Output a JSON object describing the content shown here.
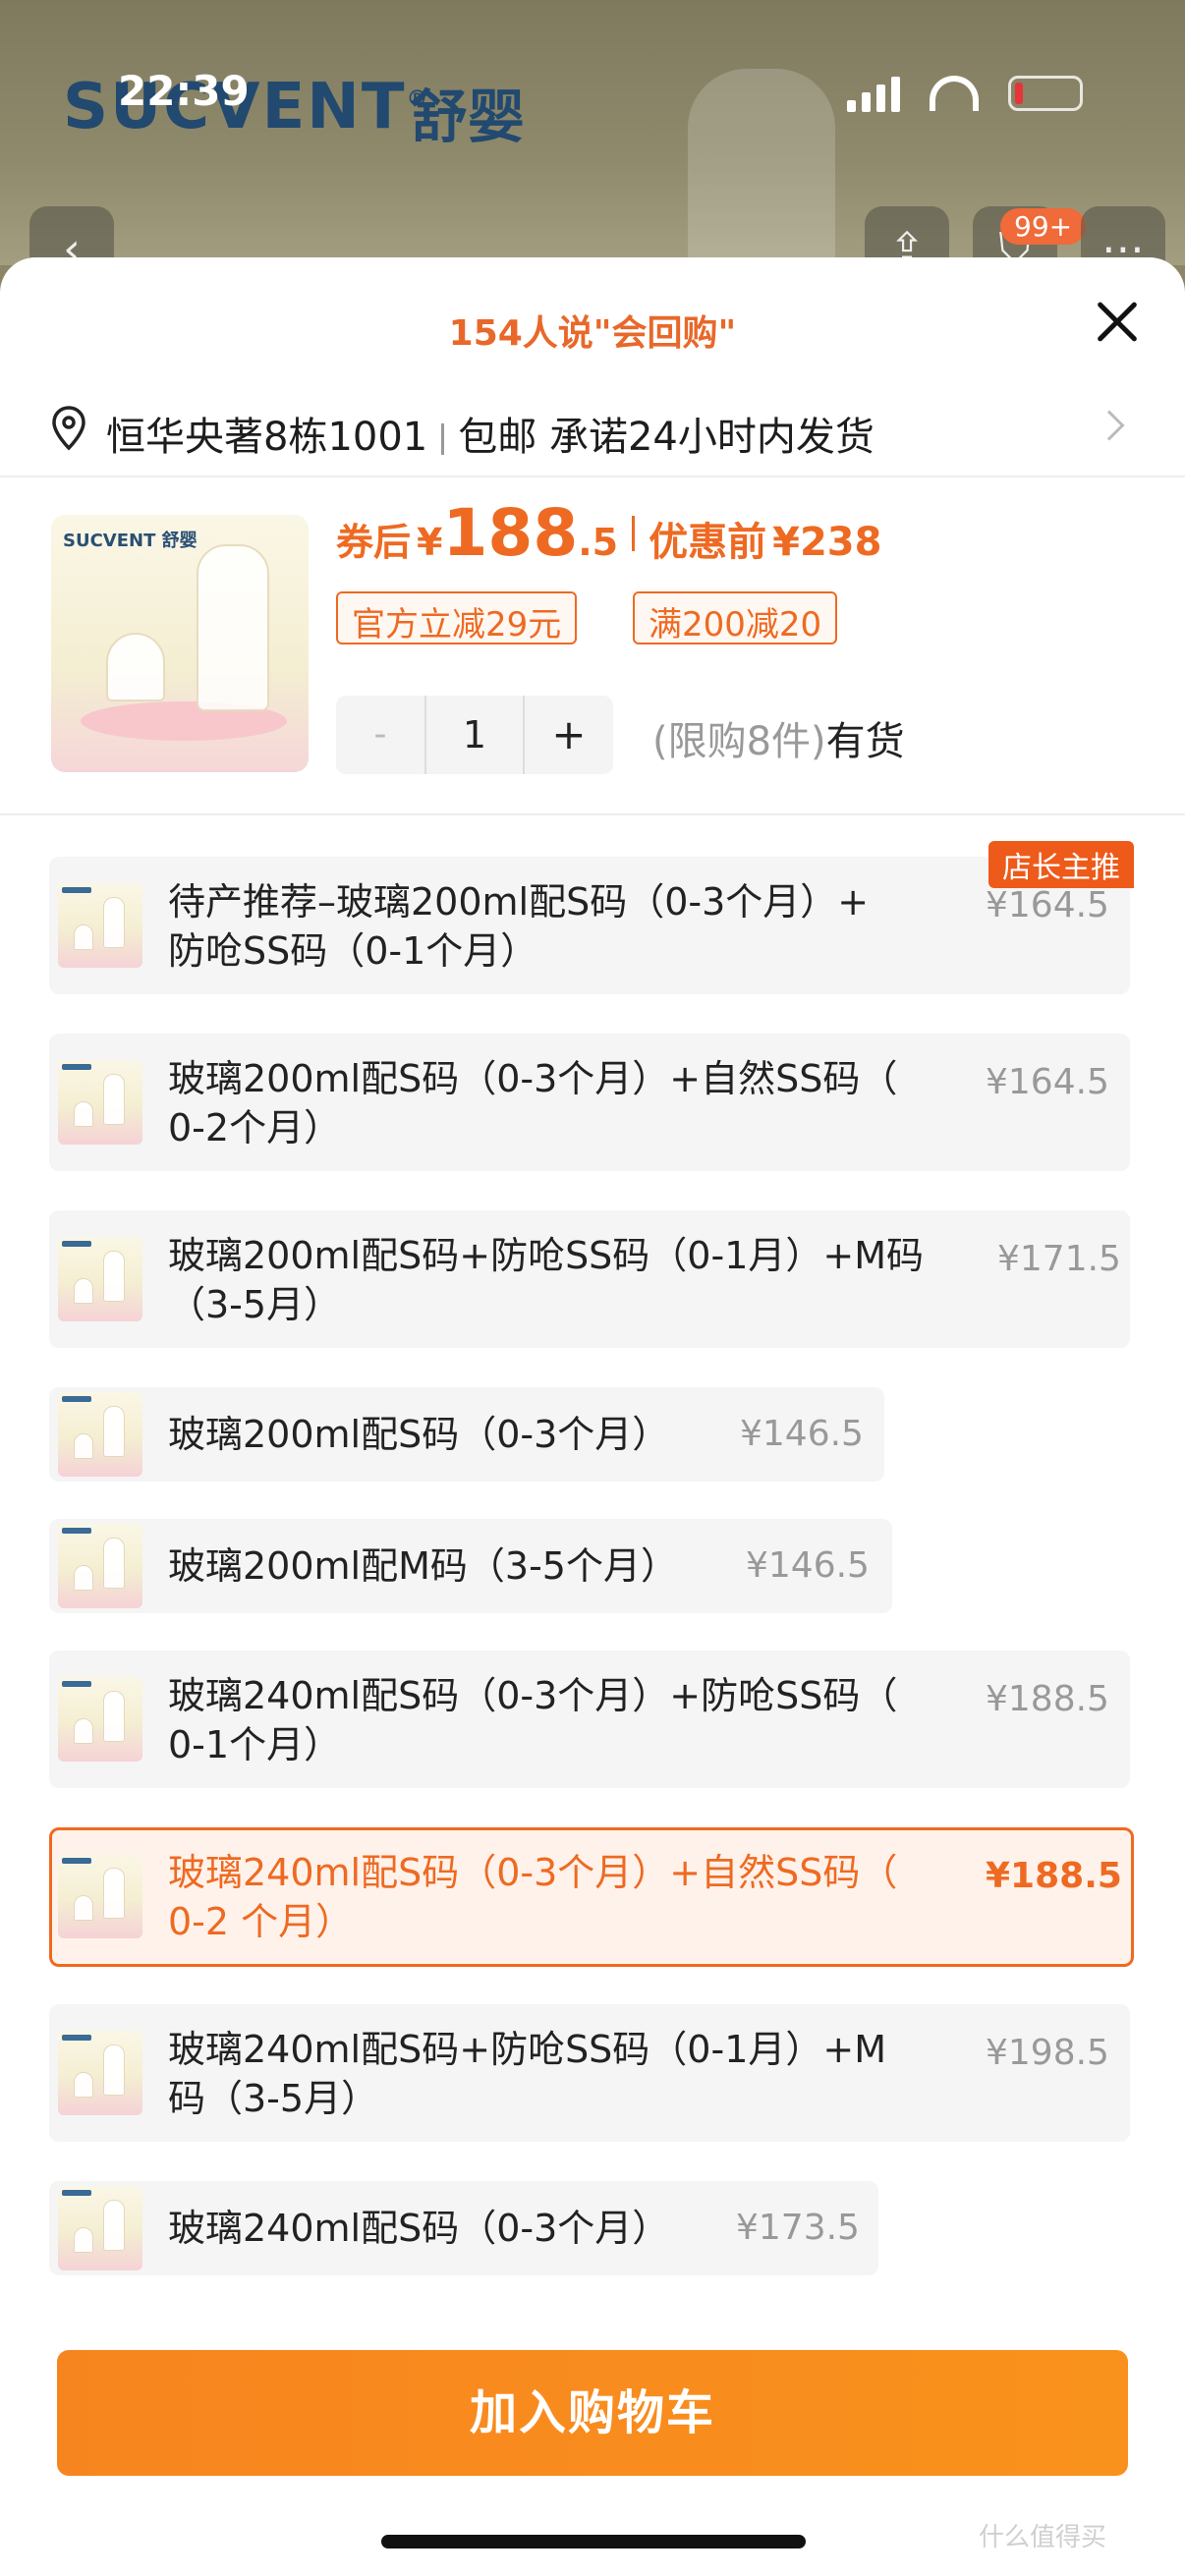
{
  "status_bar": {
    "time": "22:39"
  },
  "background": {
    "brand_logo_en": "SUCVENT",
    "brand_logo_mark": "®",
    "brand_logo_cn": "舒婴",
    "cart_badge": "99+"
  },
  "sheet": {
    "title": "154人说\"会回购\"",
    "address": "恒华央著8栋1001",
    "shipping": "包邮 承诺24小时内发货"
  },
  "product": {
    "thumb_logo": "SUCVENT 舒婴",
    "price_label": "券后",
    "currency": "¥",
    "price_integer": "188",
    "price_decimal": ".5",
    "original_label": "优惠前",
    "original_price": "¥238",
    "coupons": [
      "官方立减29元",
      "满200减20"
    ],
    "quantity": "1",
    "minus": "-",
    "plus": "+",
    "limit_text": "(限购8件)",
    "stock_text": "有货"
  },
  "recommend_tag": "店长主推",
  "options": [
    {
      "line1": "待产推荐–玻璃200ml配S码（0-3个月）+",
      "line2": "防呛SS码（0-1个月）",
      "price": "¥164.5",
      "selected": false
    },
    {
      "line1": "玻璃200ml配S码（0-3个月）+自然SS码（",
      "line2": "0-2个月）",
      "price": "¥164.5",
      "selected": false
    },
    {
      "line1": "玻璃200ml配S码+防呛SS码（0-1月）+M码",
      "line2": "（3-5月）",
      "price": "¥171.5",
      "selected": false
    },
    {
      "line1": "玻璃200ml配S码（0-3个月）",
      "line2": "",
      "price": "¥146.5",
      "selected": false
    },
    {
      "line1": "玻璃200ml配M码（3-5个月）",
      "line2": "",
      "price": "¥146.5",
      "selected": false
    },
    {
      "line1": "玻璃240ml配S码（0-3个月）+防呛SS码（",
      "line2": "0-1个月）",
      "price": "¥188.5",
      "selected": false
    },
    {
      "line1": "玻璃240ml配S码（0-3个月）+自然SS码（",
      "line2": "0-2 个月）",
      "price": "¥188.5",
      "selected": true
    },
    {
      "line1": "玻璃240ml配S码+防呛SS码（0-1月）+M",
      "line2": "码（3-5月）",
      "price": "¥198.5",
      "selected": false
    },
    {
      "line1": "玻璃240ml配S码（0-3个月）",
      "line2": "",
      "price": "¥173.5",
      "selected": false
    }
  ],
  "cart_button": "加入购物车",
  "watermark": "什么值得买",
  "colors": {
    "accent": "#ee6a22",
    "button": "#f7851f"
  }
}
